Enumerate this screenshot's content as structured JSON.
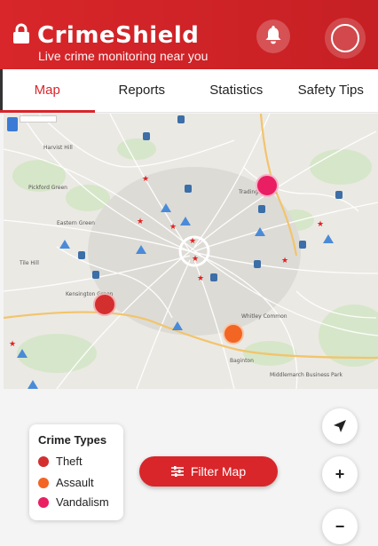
{
  "header": {
    "title": "CrimeShield",
    "subtitle": "Live crime monitoring near you",
    "icons": {
      "lock": "lock-icon",
      "bell": "bell-icon",
      "profile": "profile-icon"
    },
    "brand_color": "#d8262a"
  },
  "tabs": [
    {
      "label": "Map",
      "active": true
    },
    {
      "label": "Reports",
      "active": false
    },
    {
      "label": "Statistics",
      "active": false
    },
    {
      "label": "Safety Tips",
      "active": false
    }
  ],
  "map": {
    "incidents": [
      {
        "type": "Vandalism",
        "color": "#e91e63"
      },
      {
        "type": "Theft",
        "color": "#d32f2f"
      },
      {
        "type": "Assault",
        "color": "#f26522"
      }
    ],
    "places": [
      {
        "label": "Harvist Hill"
      },
      {
        "label": "Pickford Green"
      },
      {
        "label": "Eastern Green"
      },
      {
        "label": "Trading Estate"
      },
      {
        "label": "Kensington Green"
      },
      {
        "label": "Tile Hill"
      },
      {
        "label": "Whitley Common"
      },
      {
        "label": "Baginton"
      },
      {
        "label": "Middlemarch Business Park"
      }
    ]
  },
  "legend": {
    "title": "Crime Types",
    "items": [
      {
        "label": "Theft",
        "color": "#d32f2f"
      },
      {
        "label": "Assault",
        "color": "#f26522"
      },
      {
        "label": "Vandalism",
        "color": "#e91e63"
      }
    ]
  },
  "controls": {
    "filter_label": "Filter Map",
    "filter_icon": "sliders-icon",
    "locate_icon": "navigation-arrow-icon",
    "zoom_in_label": "+",
    "zoom_out_label": "−"
  }
}
